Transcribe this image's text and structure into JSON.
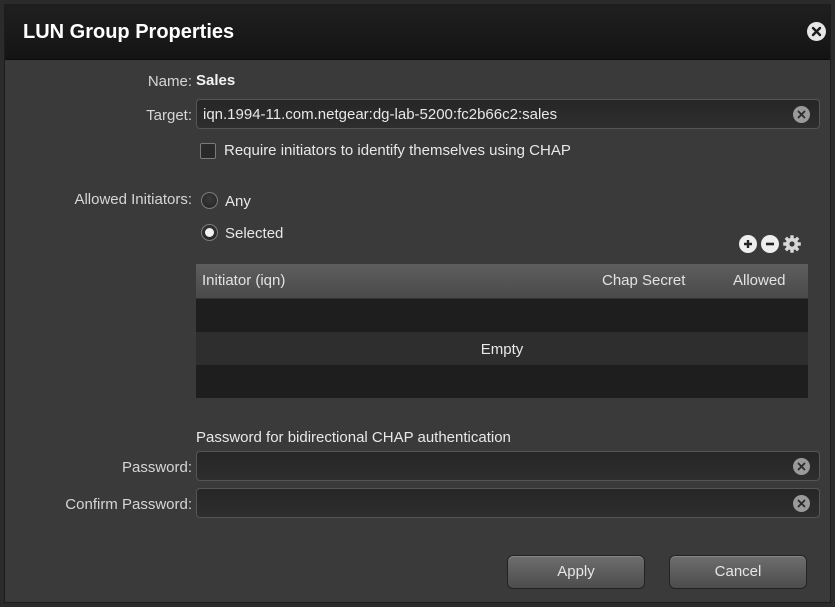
{
  "dialog": {
    "title": "LUN Group Properties"
  },
  "name": {
    "label": "Name:",
    "value": "Sales"
  },
  "target": {
    "label": "Target:",
    "value": "iqn.1994-11.com.netgear:dg-lab-5200:fc2b66c2:sales"
  },
  "chap_checkbox": {
    "label": "Require initiators to identify themselves using CHAP",
    "checked": false
  },
  "allowed_initiators": {
    "label": "Allowed Initiators:",
    "options": [
      {
        "label": "Any",
        "selected": false
      },
      {
        "label": "Selected",
        "selected": true
      }
    ]
  },
  "table": {
    "columns": [
      "Initiator (iqn)",
      "Chap Secret",
      "Allowed"
    ],
    "empty_text": "Empty"
  },
  "bidirectional": {
    "heading": "Password for bidirectional CHAP authentication",
    "password_label": "Password:",
    "password_value": "",
    "confirm_label": "Confirm Password:",
    "confirm_value": ""
  },
  "buttons": {
    "apply": "Apply",
    "cancel": "Cancel"
  },
  "icons": {
    "close": "close-icon",
    "add": "plus-circle-icon",
    "remove": "minus-circle-icon",
    "settings": "gear-icon",
    "clear": "clear-icon"
  }
}
